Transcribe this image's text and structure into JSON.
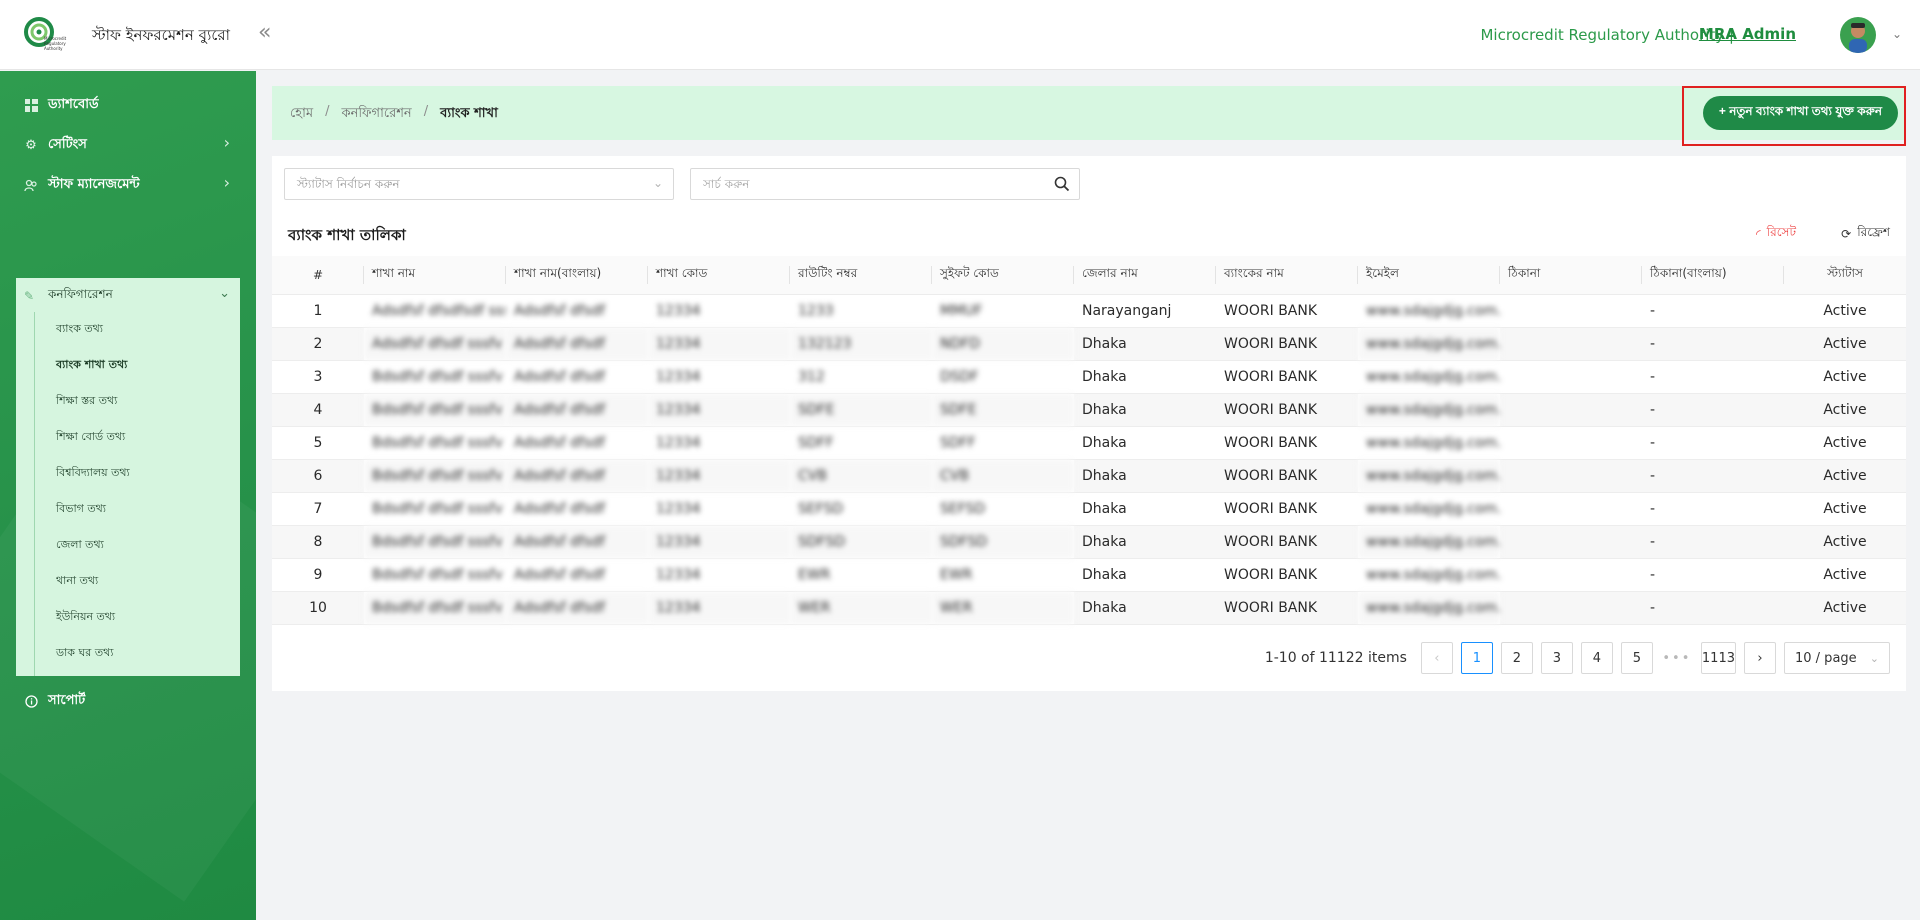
{
  "header": {
    "app_title": "স্টাফ ইনফরমেশন ব্যুরো",
    "logo_text": "Microcredit Regulatory Authority",
    "org_name": "Microcredit Regulatory Authority |",
    "user_name": "MRA Admin"
  },
  "sidebar": {
    "items": [
      {
        "label": "ড্যাশবোর্ড",
        "icon": "dashboard-icon"
      },
      {
        "label": "সেটিংস",
        "icon": "gear-icon"
      },
      {
        "label": "স্টাফ ম্যানেজমেন্ট",
        "icon": "users-icon"
      },
      {
        "label": "সাপোর্ট",
        "icon": "info-icon"
      }
    ],
    "config": {
      "label": "কনফিগারেশন",
      "sub_items": [
        "ব্যাংক তথ্য",
        "ব্যাংক শাখা তথ্য",
        "শিক্ষা স্তর তথ্য",
        "শিক্ষা বোর্ড তথ্য",
        "বিশ্ববিদ্যালয় তথ্য",
        "বিভাগ তথ্য",
        "জেলা তথ্য",
        "থানা তথ্য",
        "ইউনিয়ন তথ্য",
        "ডাক ঘর তথ্য"
      ]
    }
  },
  "breadcrumb": {
    "home": "হোম",
    "config": "কনফিগারেশন",
    "current": "ব্যাংক শাখা"
  },
  "add_button": "+ নতুন ব্যাংক শাখা তথ্য যুক্ত করুন",
  "filters": {
    "status_placeholder": "স্ট্যাটাস নির্বাচন করুন",
    "search_placeholder": "সার্চ করুন"
  },
  "list": {
    "title": "ব্যাংক শাখা তালিকা",
    "reset": "রিসেট",
    "refresh": "রিফ্রেশ"
  },
  "table": {
    "columns": [
      "#",
      "শাখা নাম",
      "শাখা নাম(বাংলায়)",
      "শাখা কোড",
      "রাউটিং নম্বর",
      "সুইফট কোড",
      "জেলার নাম",
      "ব্যাংকের নাম",
      "ইমেইল",
      "ঠিকানা",
      "ঠিকানা(বাংলায়)",
      "স্ট্যাটাস"
    ],
    "rows": [
      [
        "1",
        "Adsdfsf dfsdfsdf sssfv",
        "Adsdfsf dfsdf",
        "12334",
        "1233",
        "MMUF",
        "Narayanganj",
        "WOORI BANK",
        "www.sdajgdjg.com.bd",
        "",
        "-",
        "Active"
      ],
      [
        "2",
        "Adsdfsf dfsdf sssfv",
        "Adsdfsf dfsdf",
        "12334",
        "132123",
        "NDFD",
        "Dhaka",
        "WOORI BANK",
        "www.sdajgdjg.com.bd",
        "",
        "-",
        "Active"
      ],
      [
        "3",
        "Bdsdfsf dfsdf sssfv",
        "Adsdfsf dfsdf",
        "12334",
        "312",
        "DSDF",
        "Dhaka",
        "WOORI BANK",
        "www.sdajgdjg.com.bd",
        "",
        "-",
        "Active"
      ],
      [
        "4",
        "Bdsdfsf dfsdf sssfv",
        "Adsdfsf dfsdf",
        "12334",
        "SDFE",
        "SDFE",
        "Dhaka",
        "WOORI BANK",
        "www.sdajgdjg.com.bd",
        "",
        "-",
        "Active"
      ],
      [
        "5",
        "Bdsdfsf dfsdf sssfv",
        "Adsdfsf dfsdf",
        "12334",
        "SDFF",
        "SDFF",
        "Dhaka",
        "WOORI BANK",
        "www.sdajgdjg.com.bd",
        "",
        "-",
        "Active"
      ],
      [
        "6",
        "Bdsdfsf dfsdf sssfv",
        "Adsdfsf dfsdf",
        "12334",
        "CVB",
        "CVB",
        "Dhaka",
        "WOORI BANK",
        "www.sdajgdjg.com.bd",
        "",
        "-",
        "Active"
      ],
      [
        "7",
        "Bdsdfsf dfsdf sssfv",
        "Adsdfsf dfsdf",
        "12334",
        "SEFSD",
        "SEFSD",
        "Dhaka",
        "WOORI BANK",
        "www.sdajgdjg.com.bd",
        "",
        "-",
        "Active"
      ],
      [
        "8",
        "Bdsdfsf dfsdf sssfv",
        "Adsdfsf dfsdf",
        "12334",
        "SDFSD",
        "SDFSD",
        "Dhaka",
        "WOORI BANK",
        "www.sdajgdjg.com.bd",
        "",
        "-",
        "Active"
      ],
      [
        "9",
        "Bdsdfsf dfsdf sssfv",
        "Adsdfsf dfsdf",
        "12334",
        "EWR",
        "EWR",
        "Dhaka",
        "WOORI BANK",
        "www.sdajgdjg.com.bd",
        "",
        "-",
        "Active"
      ],
      [
        "10",
        "Bdsdfsf dfsdf sssfv",
        "Adsdfsf dfsdf",
        "12334",
        "WER",
        "WER",
        "Dhaka",
        "WOORI BANK",
        "www.sdajgdjg.com.bd",
        "",
        "-",
        "Active"
      ]
    ],
    "blurred_columns": [
      1,
      2,
      3,
      4,
      5,
      8
    ]
  },
  "pagination": {
    "total_text": "1-10 of 11122 items",
    "pages": [
      "1",
      "2",
      "3",
      "4",
      "5"
    ],
    "active_page": "1",
    "dots": "•••",
    "last_page": "1113",
    "page_size": "10 / page"
  },
  "colors": {
    "brand_green": "#1f8a47",
    "active_status": "#2c9a4a",
    "highlight_red": "#e02020"
  }
}
